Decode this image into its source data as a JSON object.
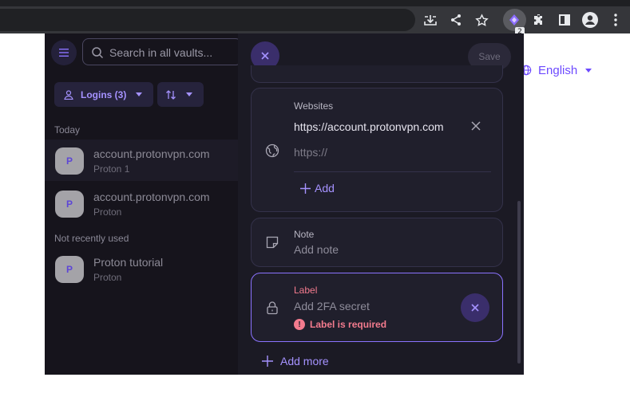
{
  "browser": {
    "extension_badge": "2"
  },
  "page": {
    "language": "English",
    "accent": "#6d4aff"
  },
  "sidebar": {
    "search_placeholder": "Search in all vaults...",
    "filter_label": "Logins (3)",
    "sections": [
      {
        "label": "Today",
        "items": [
          {
            "avatar": "P",
            "title": "account.protonvpn.com",
            "subtitle": "Proton 1"
          },
          {
            "avatar": "P",
            "title": "account.protonvpn.com",
            "subtitle": "Proton"
          }
        ]
      },
      {
        "label": "Not recently used",
        "items": [
          {
            "avatar": "P",
            "title": "Proton tutorial",
            "subtitle": "Proton"
          }
        ]
      }
    ]
  },
  "editor": {
    "save_label": "Save",
    "websites": {
      "label": "Websites",
      "url_value": "https://account.protonvpn.com",
      "url_placeholder": "https://",
      "add_label": "Add"
    },
    "note": {
      "label": "Note",
      "placeholder": "Add note"
    },
    "twofa": {
      "label": "Label",
      "placeholder": "Add 2FA secret",
      "error": "Label is required",
      "error_color": "#f37b8e"
    },
    "add_more_label": "Add more"
  }
}
